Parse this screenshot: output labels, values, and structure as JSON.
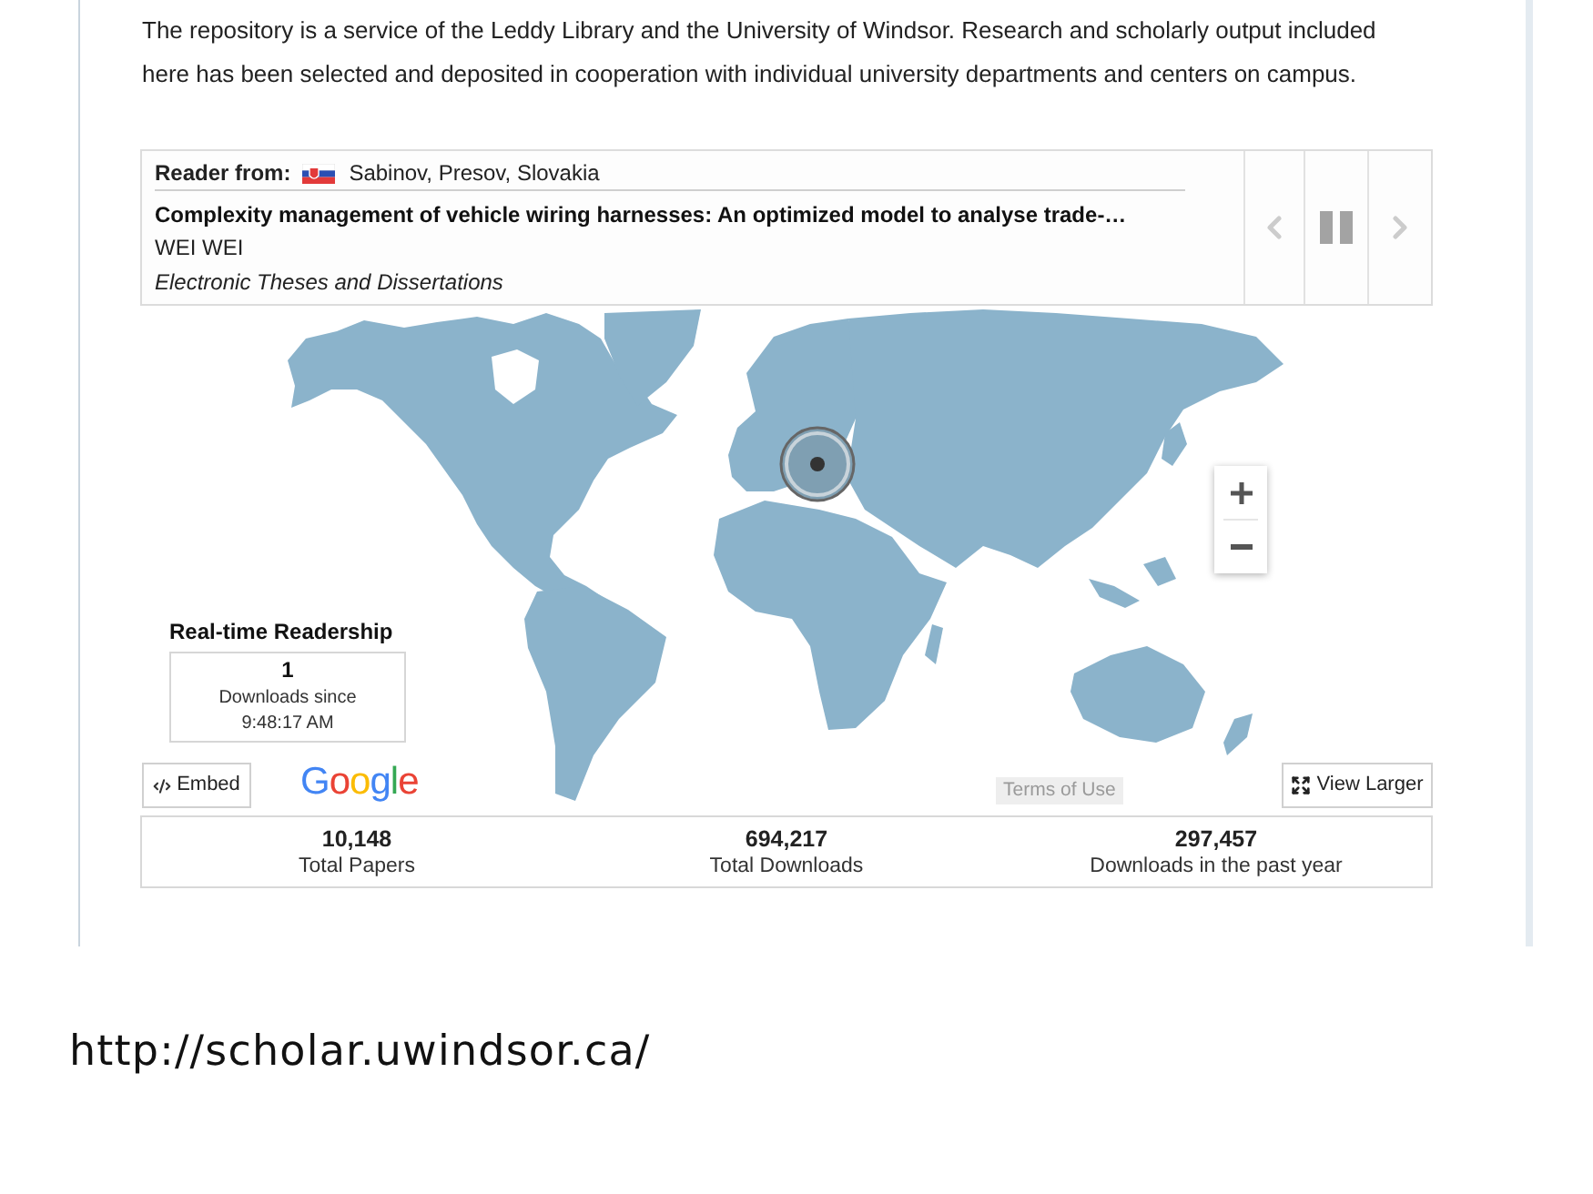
{
  "intro": {
    "text": "The repository is a service of the Leddy Library and the University of Windsor. Research and scholarly output included here has been selected and deposited in cooperation with individual university departments and centers on campus."
  },
  "reader": {
    "label": "Reader from:",
    "location": "Sabinov, Presov, Slovakia",
    "title": "Complexity management of vehicle wiring harnesses: An optimized model to analyse trade-…",
    "author": "WEI WEI",
    "collection": "Electronic Theses and Dissertations"
  },
  "map": {
    "readership": {
      "title": "Real-time Readership",
      "count": "1",
      "caption": "Downloads since",
      "time": "9:48:17 AM"
    },
    "embed_button": "Embed",
    "logo": "Google",
    "terms": "Terms of Use",
    "view_larger_button": "View Larger"
  },
  "stats": [
    {
      "value": "10,148",
      "label": "Total Papers"
    },
    {
      "value": "694,217",
      "label": "Total Downloads"
    },
    {
      "value": "297,457",
      "label": "Downloads in the past year"
    }
  ],
  "caption": {
    "url": "http://scholar.uwindsor.ca/"
  }
}
